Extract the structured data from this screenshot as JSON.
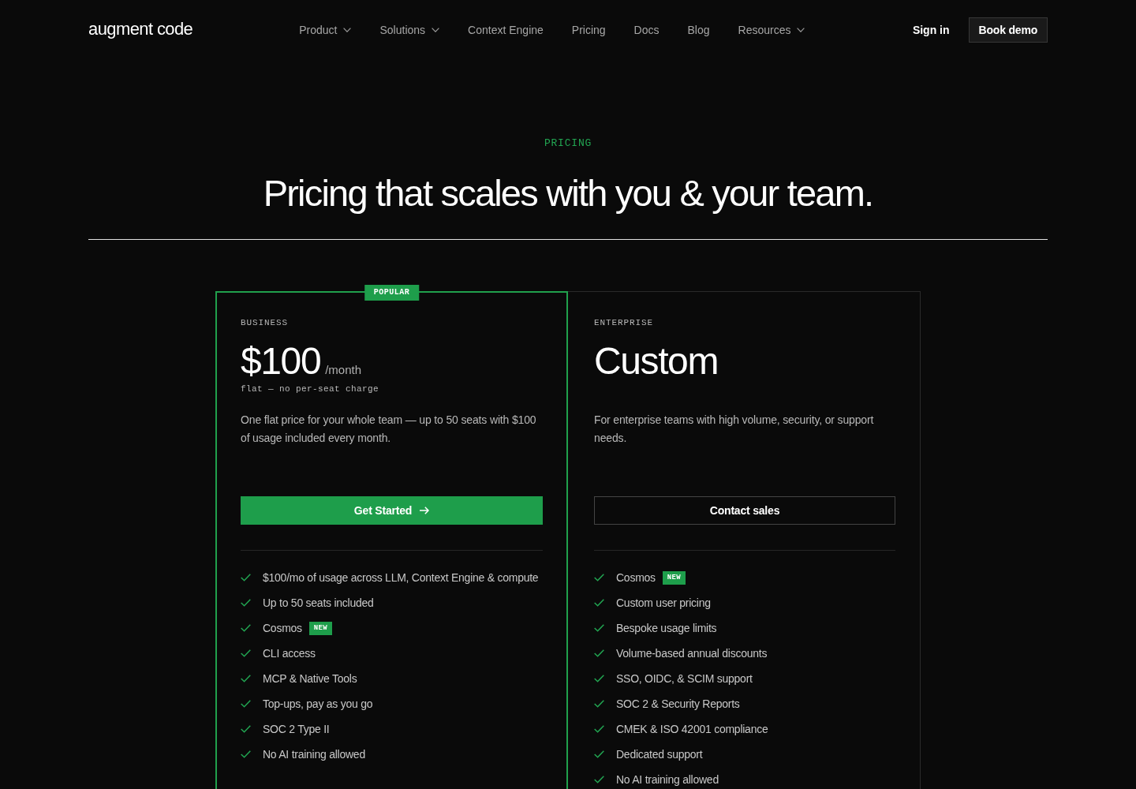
{
  "nav": {
    "logo": "augment code",
    "links": [
      {
        "label": "Product",
        "dropdown": true
      },
      {
        "label": "Solutions",
        "dropdown": true
      },
      {
        "label": "Context Engine",
        "dropdown": false
      },
      {
        "label": "Pricing",
        "dropdown": false
      },
      {
        "label": "Docs",
        "dropdown": false
      },
      {
        "label": "Blog",
        "dropdown": false
      },
      {
        "label": "Resources",
        "dropdown": true
      }
    ],
    "sign_in": "Sign in",
    "book_demo": "Book demo"
  },
  "hero": {
    "eyebrow": "PRICING",
    "title": "Pricing that scales with you & your team."
  },
  "plans": [
    {
      "highlighted": true,
      "badge": "POPULAR",
      "tier": "BUSINESS",
      "price": "$100",
      "period": "/month",
      "note": "flat — no per-seat charge",
      "description": "One flat price for your whole team — up to 50 seats with $100 of usage included every month.",
      "cta": {
        "label": "Get Started",
        "kind": "primary",
        "arrow": true
      },
      "features": [
        {
          "text": "$100/mo of usage across LLM, Context Engine & compute"
        },
        {
          "text": "Up to 50 seats included"
        },
        {
          "text": "Cosmos",
          "badge": "NEW"
        },
        {
          "text": "CLI access"
        },
        {
          "text": "MCP & Native Tools"
        },
        {
          "text": "Top-ups, pay as you go"
        },
        {
          "text": "SOC 2 Type II"
        },
        {
          "text": "No AI training allowed"
        }
      ]
    },
    {
      "highlighted": false,
      "tier": "ENTERPRISE",
      "price": "Custom",
      "description": "For enterprise teams with high volume, security, or support needs.",
      "cta": {
        "label": "Contact sales",
        "kind": "outline",
        "arrow": false
      },
      "features": [
        {
          "text": "Cosmos",
          "badge": "NEW"
        },
        {
          "text": "Custom user pricing"
        },
        {
          "text": "Bespoke usage limits"
        },
        {
          "text": "Volume-based annual discounts"
        },
        {
          "text": "SSO, OIDC, & SCIM support"
        },
        {
          "text": "SOC 2 & Security Reports"
        },
        {
          "text": "CMEK & ISO 42001 compliance"
        },
        {
          "text": "Dedicated support"
        },
        {
          "text": "No AI training allowed"
        }
      ]
    }
  ]
}
